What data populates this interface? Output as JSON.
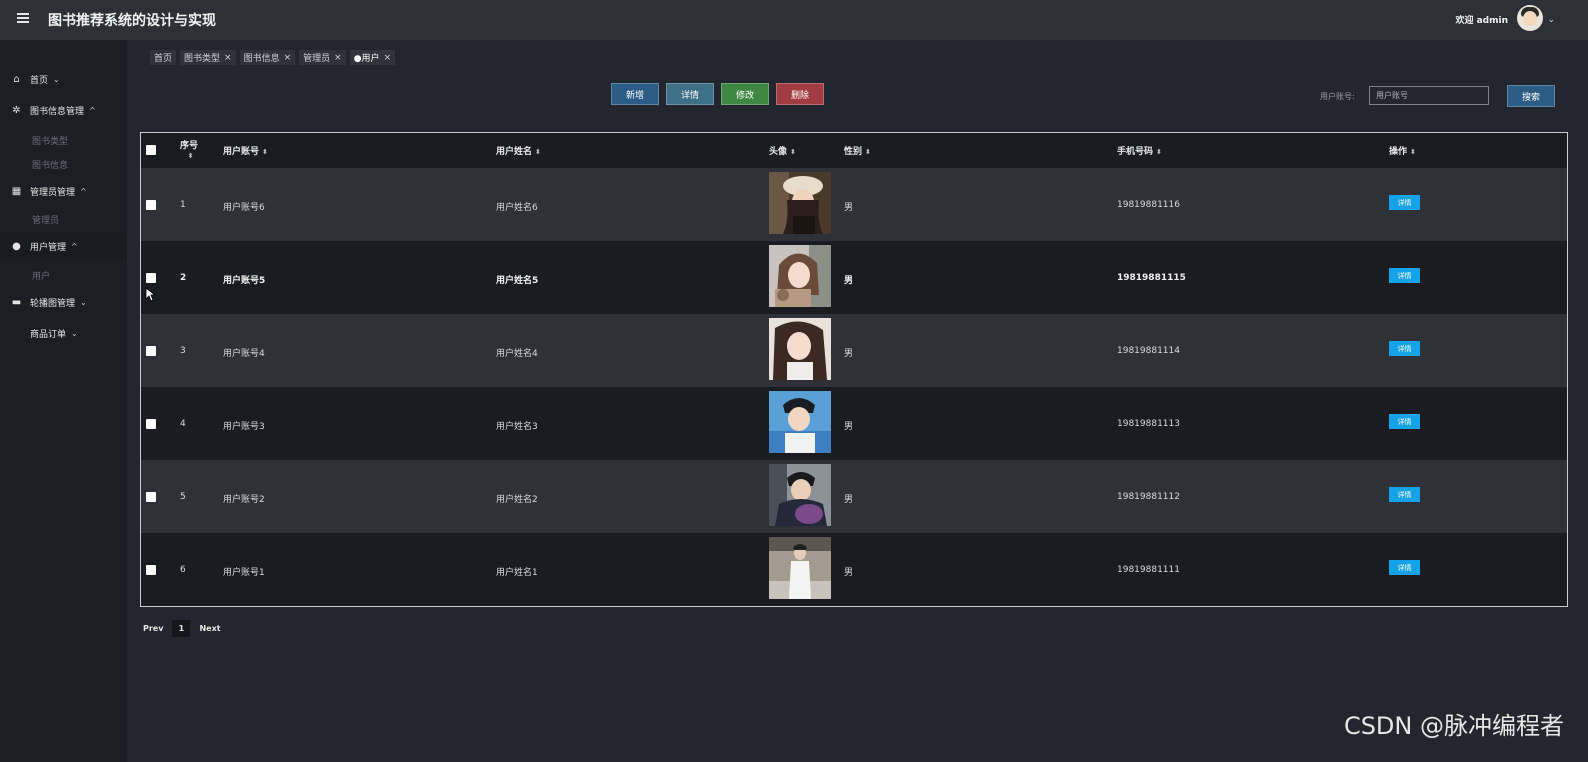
{
  "header": {
    "title": "图书推荐系统的设计与实现",
    "welcome": "欢迎 admin"
  },
  "sidebar": {
    "items": [
      {
        "label": "首页",
        "icon": "home-icon"
      },
      {
        "label": "图书信息管理",
        "icon": "gear-icon",
        "children": [
          "图书类型",
          "图书信息"
        ]
      },
      {
        "label": "管理员管理",
        "icon": "table-icon",
        "children": [
          "管理员"
        ]
      },
      {
        "label": "用户管理",
        "icon": "user-icon",
        "children": [
          "用户"
        ]
      },
      {
        "label": "轮播图管理",
        "icon": "card-icon"
      },
      {
        "label": "商品订单"
      }
    ]
  },
  "tabs": [
    {
      "label": "首页"
    },
    {
      "label": "图书类型"
    },
    {
      "label": "图书信息"
    },
    {
      "label": "管理员"
    },
    {
      "label": "●用户"
    }
  ],
  "toolbar": {
    "add": "新增",
    "detail": "详情",
    "edit": "修改",
    "delete": "删除",
    "search_label": "用户账号:",
    "search_placeholder": "用户账号",
    "search_button": "搜索"
  },
  "table": {
    "columns": [
      "序号",
      "用户账号",
      "用户姓名",
      "头像",
      "性别",
      "手机号码",
      "操作"
    ],
    "rows": [
      {
        "index": "1",
        "account": "用户账号6",
        "name": "用户姓名6",
        "gender": "男",
        "phone": "19819881116",
        "action": "详情"
      },
      {
        "index": "2",
        "account": "用户账号5",
        "name": "用户姓名5",
        "gender": "男",
        "phone": "19819881115",
        "action": "详情"
      },
      {
        "index": "3",
        "account": "用户账号4",
        "name": "用户姓名4",
        "gender": "男",
        "phone": "19819881114",
        "action": "详情"
      },
      {
        "index": "4",
        "account": "用户账号3",
        "name": "用户姓名3",
        "gender": "男",
        "phone": "19819881113",
        "action": "详情"
      },
      {
        "index": "5",
        "account": "用户账号2",
        "name": "用户姓名2",
        "gender": "男",
        "phone": "19819881112",
        "action": "详情"
      },
      {
        "index": "6",
        "account": "用户账号1",
        "name": "用户姓名1",
        "gender": "男",
        "phone": "19819881111",
        "action": "详情"
      }
    ]
  },
  "pager": {
    "prev": "Prev",
    "current": "1",
    "next": "Next"
  },
  "watermark": "CSDN @脉冲编程者",
  "colors": {
    "accent": "#14a3e8",
    "add": "#2b5c86",
    "edit": "#3e8843",
    "delete": "#a23c43"
  }
}
